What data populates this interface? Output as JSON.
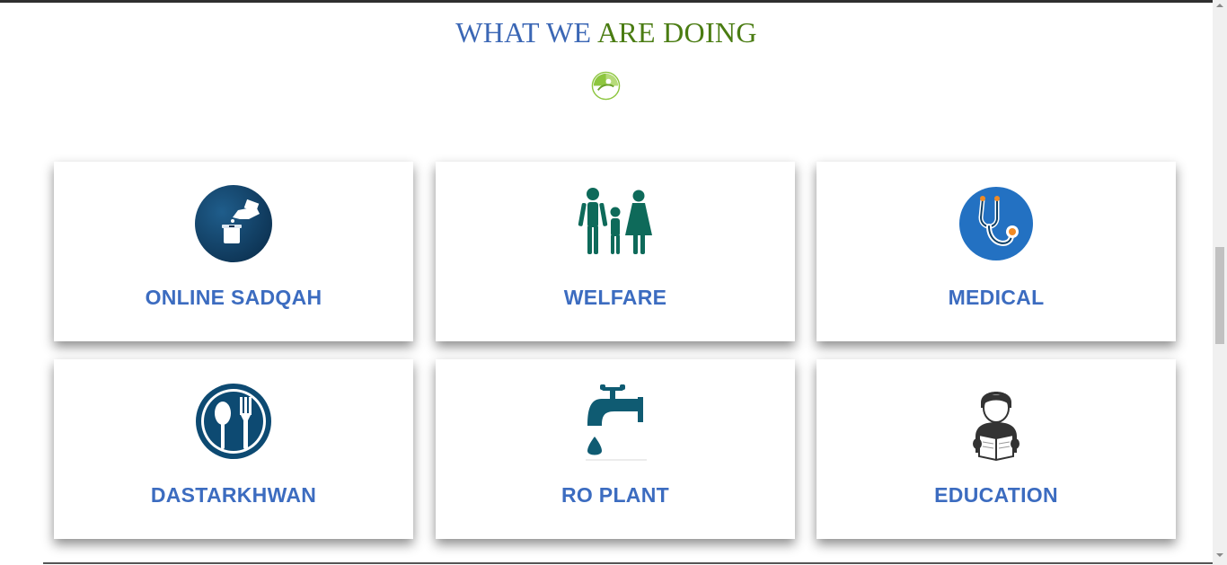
{
  "section": {
    "title_part1": "WHAT WE",
    "title_part2": "ARE DOING",
    "title_colors": [
      "#3b67b5",
      "#4a7c12"
    ]
  },
  "cards": [
    {
      "label": "ONLINE SADQAH",
      "icon": "donation-hand-icon"
    },
    {
      "label": "WELFARE",
      "icon": "family-icon"
    },
    {
      "label": "MEDICAL",
      "icon": "stethoscope-icon"
    },
    {
      "label": "DASTARKHWAN",
      "icon": "spoon-fork-icon"
    },
    {
      "label": "RO PLANT",
      "icon": "water-tap-icon"
    },
    {
      "label": "EDUCATION",
      "icon": "student-reading-icon"
    }
  ],
  "colors": {
    "label": "#3c6cc0",
    "teal": "#0e6a5a",
    "navy": "#0d3f66",
    "blue": "#2371c2"
  }
}
